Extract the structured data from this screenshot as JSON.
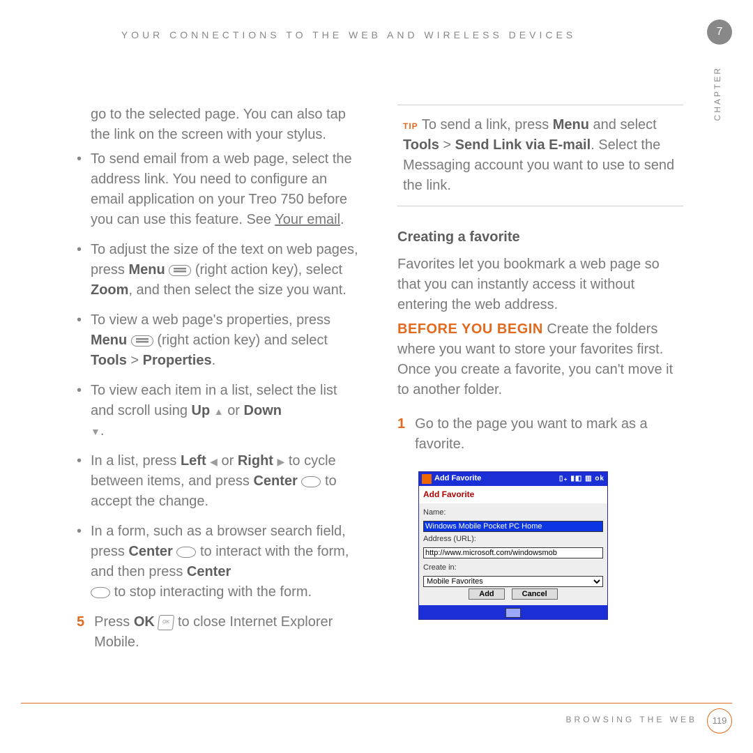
{
  "header": "YOUR CONNECTIONS TO THE WEB AND WIRELESS DEVICES",
  "chapter_num": "7",
  "chapter_label": "CHAPTER",
  "left": {
    "intro": "go to the selected page. You can also tap the link on the screen with your stylus.",
    "b1a": "To send email from a web page, select the address link. You need to configure an email application on your Treo 750 before you can use this feature. See ",
    "b1b": "Your email",
    "b1c": ".",
    "b2a": "To adjust the size of the text on web pages, press ",
    "b2b": "Menu",
    "b2c": " (right action key), select ",
    "b2d": "Zoom",
    "b2e": ", and then select the size you want.",
    "b3a": "To view a web page's properties, press ",
    "b3b": "Menu",
    "b3c": " (right action key) and select ",
    "b3d": "Tools",
    "b3e": " > ",
    "b3f": "Properties",
    "b3g": ".",
    "b4a": "To view each item in a list, select the list and scroll using ",
    "b4b": "Up",
    "b4c": " or ",
    "b4d": "Down",
    "b4e": ".",
    "b5a": "In a list, press ",
    "b5b": "Left",
    "b5c": " or ",
    "b5d": "Right",
    "b5e": " to cycle between items, and press ",
    "b5f": "Center",
    "b5g": " to accept the change.",
    "b6a": "In a form, such as a browser search field, press ",
    "b6b": "Center",
    "b6c": " to interact with the form, and then press ",
    "b6d": "Center",
    "b6e": " to stop interacting with the form.",
    "step_num": "5",
    "s5a": "Press ",
    "s5b": "OK",
    "s5c": " to close Internet Explorer Mobile."
  },
  "right": {
    "tip_tag": "TIP",
    "tip_a": " To send a link, press ",
    "tip_b": "Menu",
    "tip_c": " and select ",
    "tip_d": "Tools",
    "tip_e": " > ",
    "tip_f": "Send Link via E-mail",
    "tip_g": ". Select the Messaging account you want to use to send the link.",
    "h1": "Creating a favorite",
    "p1": "Favorites let you bookmark a web page so that you can instantly access it without entering the web address.",
    "byb": "BEFORE YOU BEGIN",
    "p2": " Create the folders where you want to store your favorites first. Once you create a favorite, you can't move it to another folder.",
    "n1_num": "1",
    "n1_txt": "Go to the page you want to mark as a favorite."
  },
  "shot": {
    "titlebar": "Add Favorite",
    "heading": "Add Favorite",
    "name_label": "Name:",
    "name_value": "Windows Mobile Pocket PC Home",
    "url_label": "Address (URL):",
    "url_value": "http://www.microsoft.com/windowsmob",
    "folder_label": "Create in:",
    "folder_value": "Mobile Favorites",
    "add": "Add",
    "cancel": "Cancel"
  },
  "footer": "BROWSING THE WEB",
  "page_num": "119"
}
